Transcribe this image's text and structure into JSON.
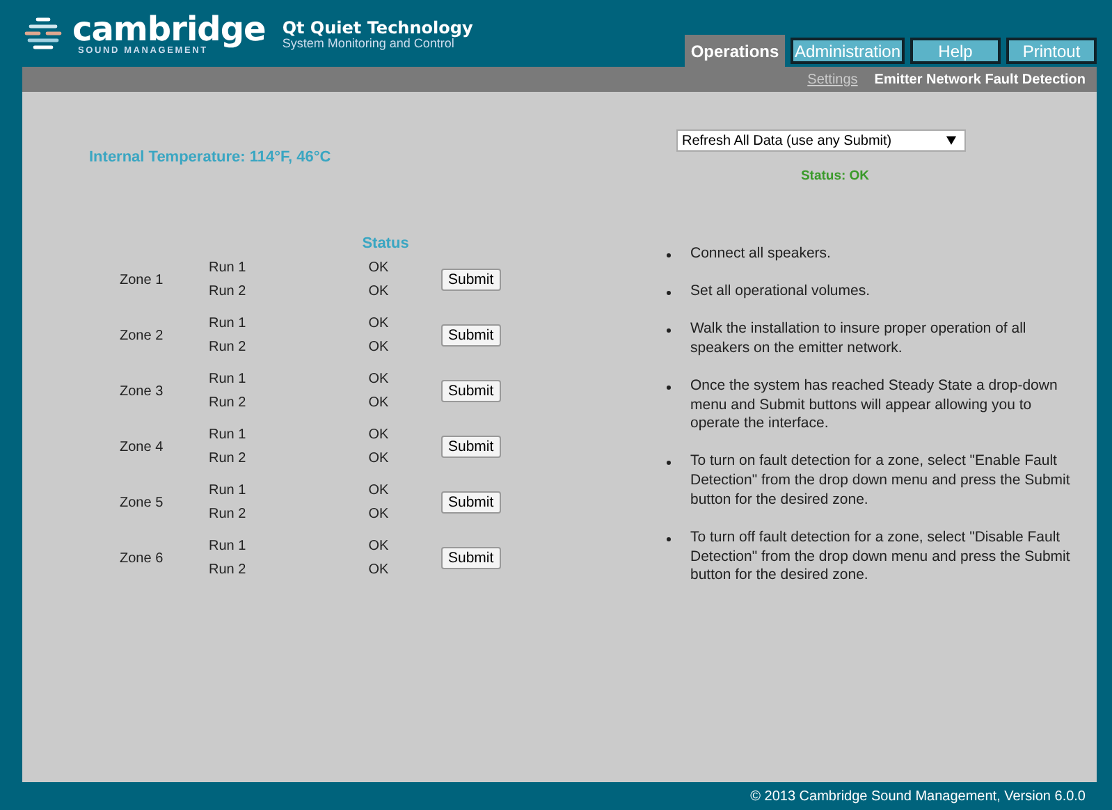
{
  "brand": {
    "name": "cambridge",
    "tagline": "SOUND MANAGEMENT",
    "product": "Qt Quiet Technology",
    "subtitle": "System Monitoring and Control"
  },
  "tabs": [
    {
      "label": "Operations",
      "selected": true
    },
    {
      "label": "Administration",
      "selected": false
    },
    {
      "label": "Help",
      "selected": false
    },
    {
      "label": "Printout",
      "selected": false
    }
  ],
  "subnav": [
    {
      "label": "Settings",
      "selected": false
    },
    {
      "label": "Emitter Network Fault Detection",
      "selected": true
    }
  ],
  "temperature": "Internal Temperature: 114°F, 46°C",
  "action_select": {
    "value": "Refresh All Data (use any Submit)"
  },
  "status": "Status: OK",
  "zones": {
    "status_heading": "Status",
    "rows": [
      {
        "name": "Zone 1",
        "runs": [
          {
            "label": "Run 1",
            "status": "OK"
          },
          {
            "label": "Run 2",
            "status": "OK"
          }
        ],
        "button": "Submit"
      },
      {
        "name": "Zone 2",
        "runs": [
          {
            "label": "Run 1",
            "status": "OK"
          },
          {
            "label": "Run 2",
            "status": "OK"
          }
        ],
        "button": "Submit"
      },
      {
        "name": "Zone 3",
        "runs": [
          {
            "label": "Run 1",
            "status": "OK"
          },
          {
            "label": "Run 2",
            "status": "OK"
          }
        ],
        "button": "Submit"
      },
      {
        "name": "Zone 4",
        "runs": [
          {
            "label": "Run 1",
            "status": "OK"
          },
          {
            "label": "Run 2",
            "status": "OK"
          }
        ],
        "button": "Submit"
      },
      {
        "name": "Zone 5",
        "runs": [
          {
            "label": "Run 1",
            "status": "OK"
          },
          {
            "label": "Run 2",
            "status": "OK"
          }
        ],
        "button": "Submit"
      },
      {
        "name": "Zone 6",
        "runs": [
          {
            "label": "Run 1",
            "status": "OK"
          },
          {
            "label": "Run 2",
            "status": "OK"
          }
        ],
        "button": "Submit"
      }
    ]
  },
  "instructions": [
    "Connect all speakers.",
    "Set all operational volumes.",
    "Walk the installation to insure proper operation of all speakers on the emitter network.",
    "Once the system has reached Steady State a drop-down menu and Submit buttons will appear allowing you to operate the interface.",
    "To turn on fault detection for a zone, select \"Enable Fault Detection\" from the drop down menu and press the Submit button for the desired zone.",
    "To turn off fault detection for a zone, select \"Disable Fault Detection\" from the drop down menu and press the Submit button for the desired zone."
  ],
  "footer": "© 2013  Cambridge Sound Management,  Version 6.0.0"
}
